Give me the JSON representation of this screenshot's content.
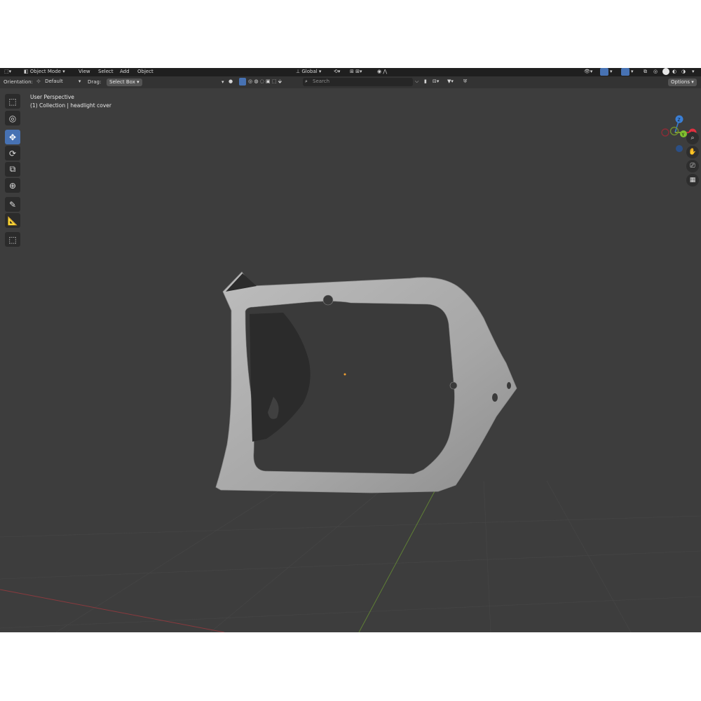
{
  "header": {
    "mode_label": "Object Mode",
    "menus": [
      "View",
      "Select",
      "Add",
      "Object"
    ],
    "transform_space": "Global"
  },
  "toolbar": {
    "orientation_label": "Orientation:",
    "orientation_value": "Default",
    "drag_label": "Drag:",
    "drag_value": "Select Box",
    "search_placeholder": "Search",
    "options_label": "Options"
  },
  "viewport": {
    "perspective_label": "User Perspective",
    "collection_label": "(1) Collection | headlight cover"
  },
  "gizmo": {
    "z_label": "Z",
    "y_label": "Y",
    "x_label": "X",
    "colors": {
      "x": "#e0303f",
      "y": "#7fbf2f",
      "z": "#3a7fd6"
    }
  },
  "tools": [
    {
      "name": "select-box-icon",
      "active": false
    },
    {
      "name": "cursor-icon",
      "active": false
    },
    {
      "name": "move-icon",
      "active": true
    },
    {
      "name": "rotate-icon",
      "active": false
    },
    {
      "name": "scale-icon",
      "active": false
    },
    {
      "name": "transform-icon",
      "active": false
    },
    {
      "name": "annotate-icon",
      "active": false
    },
    {
      "name": "measure-icon",
      "active": false
    },
    {
      "name": "add-cube-icon",
      "active": false
    }
  ],
  "nav": [
    "zoom-icon",
    "hand-icon",
    "camera-icon",
    "grid-icon"
  ],
  "colors": {
    "accent": "#4772b3",
    "viewport_bg": "#3d3d3d",
    "object": "#a9a9a9"
  }
}
